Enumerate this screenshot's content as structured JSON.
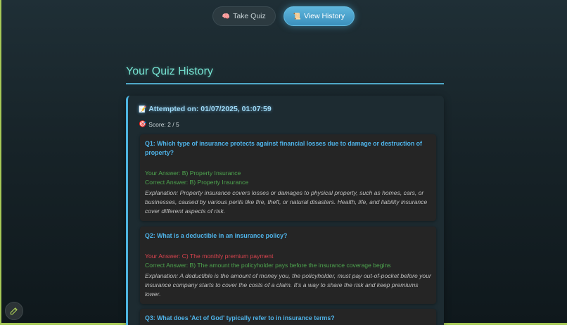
{
  "nav": {
    "take_quiz": {
      "icon": "🧠",
      "label": "Take Quiz"
    },
    "view_history": {
      "icon": "📜",
      "label": "View History"
    }
  },
  "page": {
    "heading": "Your Quiz History"
  },
  "attempt": {
    "title_icon": "📝",
    "title": "Attempted on: 01/07/2025, 01:07:59",
    "score_icon": "🎯",
    "score": "Score: 2 / 5",
    "questions": [
      {
        "question": "Q1: Which type of insurance protects against financial losses due to damage or destruction of property?",
        "your_answer": "Your Answer: B) Property Insurance",
        "correct_answer": "Correct Answer: B) Property Insurance",
        "explanation": "Explanation: Property insurance covers losses or damages to physical property, such as homes, cars, or businesses, caused by various perils like fire, theft, or natural disasters. Health, life, and liability insurance cover different aspects of risk."
      },
      {
        "question": "Q2: What is a deductible in an insurance policy?",
        "your_answer": "Your Answer: C) The monthly premium payment",
        "correct_answer": "Correct Answer: B) The amount the policyholder pays before the insurance coverage begins",
        "explanation": "Explanation: A deductible is the amount of money you, the policyholder, must pay out-of-pocket before your insurance company starts to cover the costs of a claim. It's a way to share the risk and keep premiums lower."
      },
      {
        "question": "Q3: What does 'Act of God' typically refer to in insurance terms?"
      }
    ]
  },
  "colors": {
    "accent": "#4fb4ea",
    "heading": "#74e1d0",
    "correct": "#4ea64f",
    "wrong": "#d9434e"
  },
  "icons": {
    "edit": "pencil-icon"
  }
}
